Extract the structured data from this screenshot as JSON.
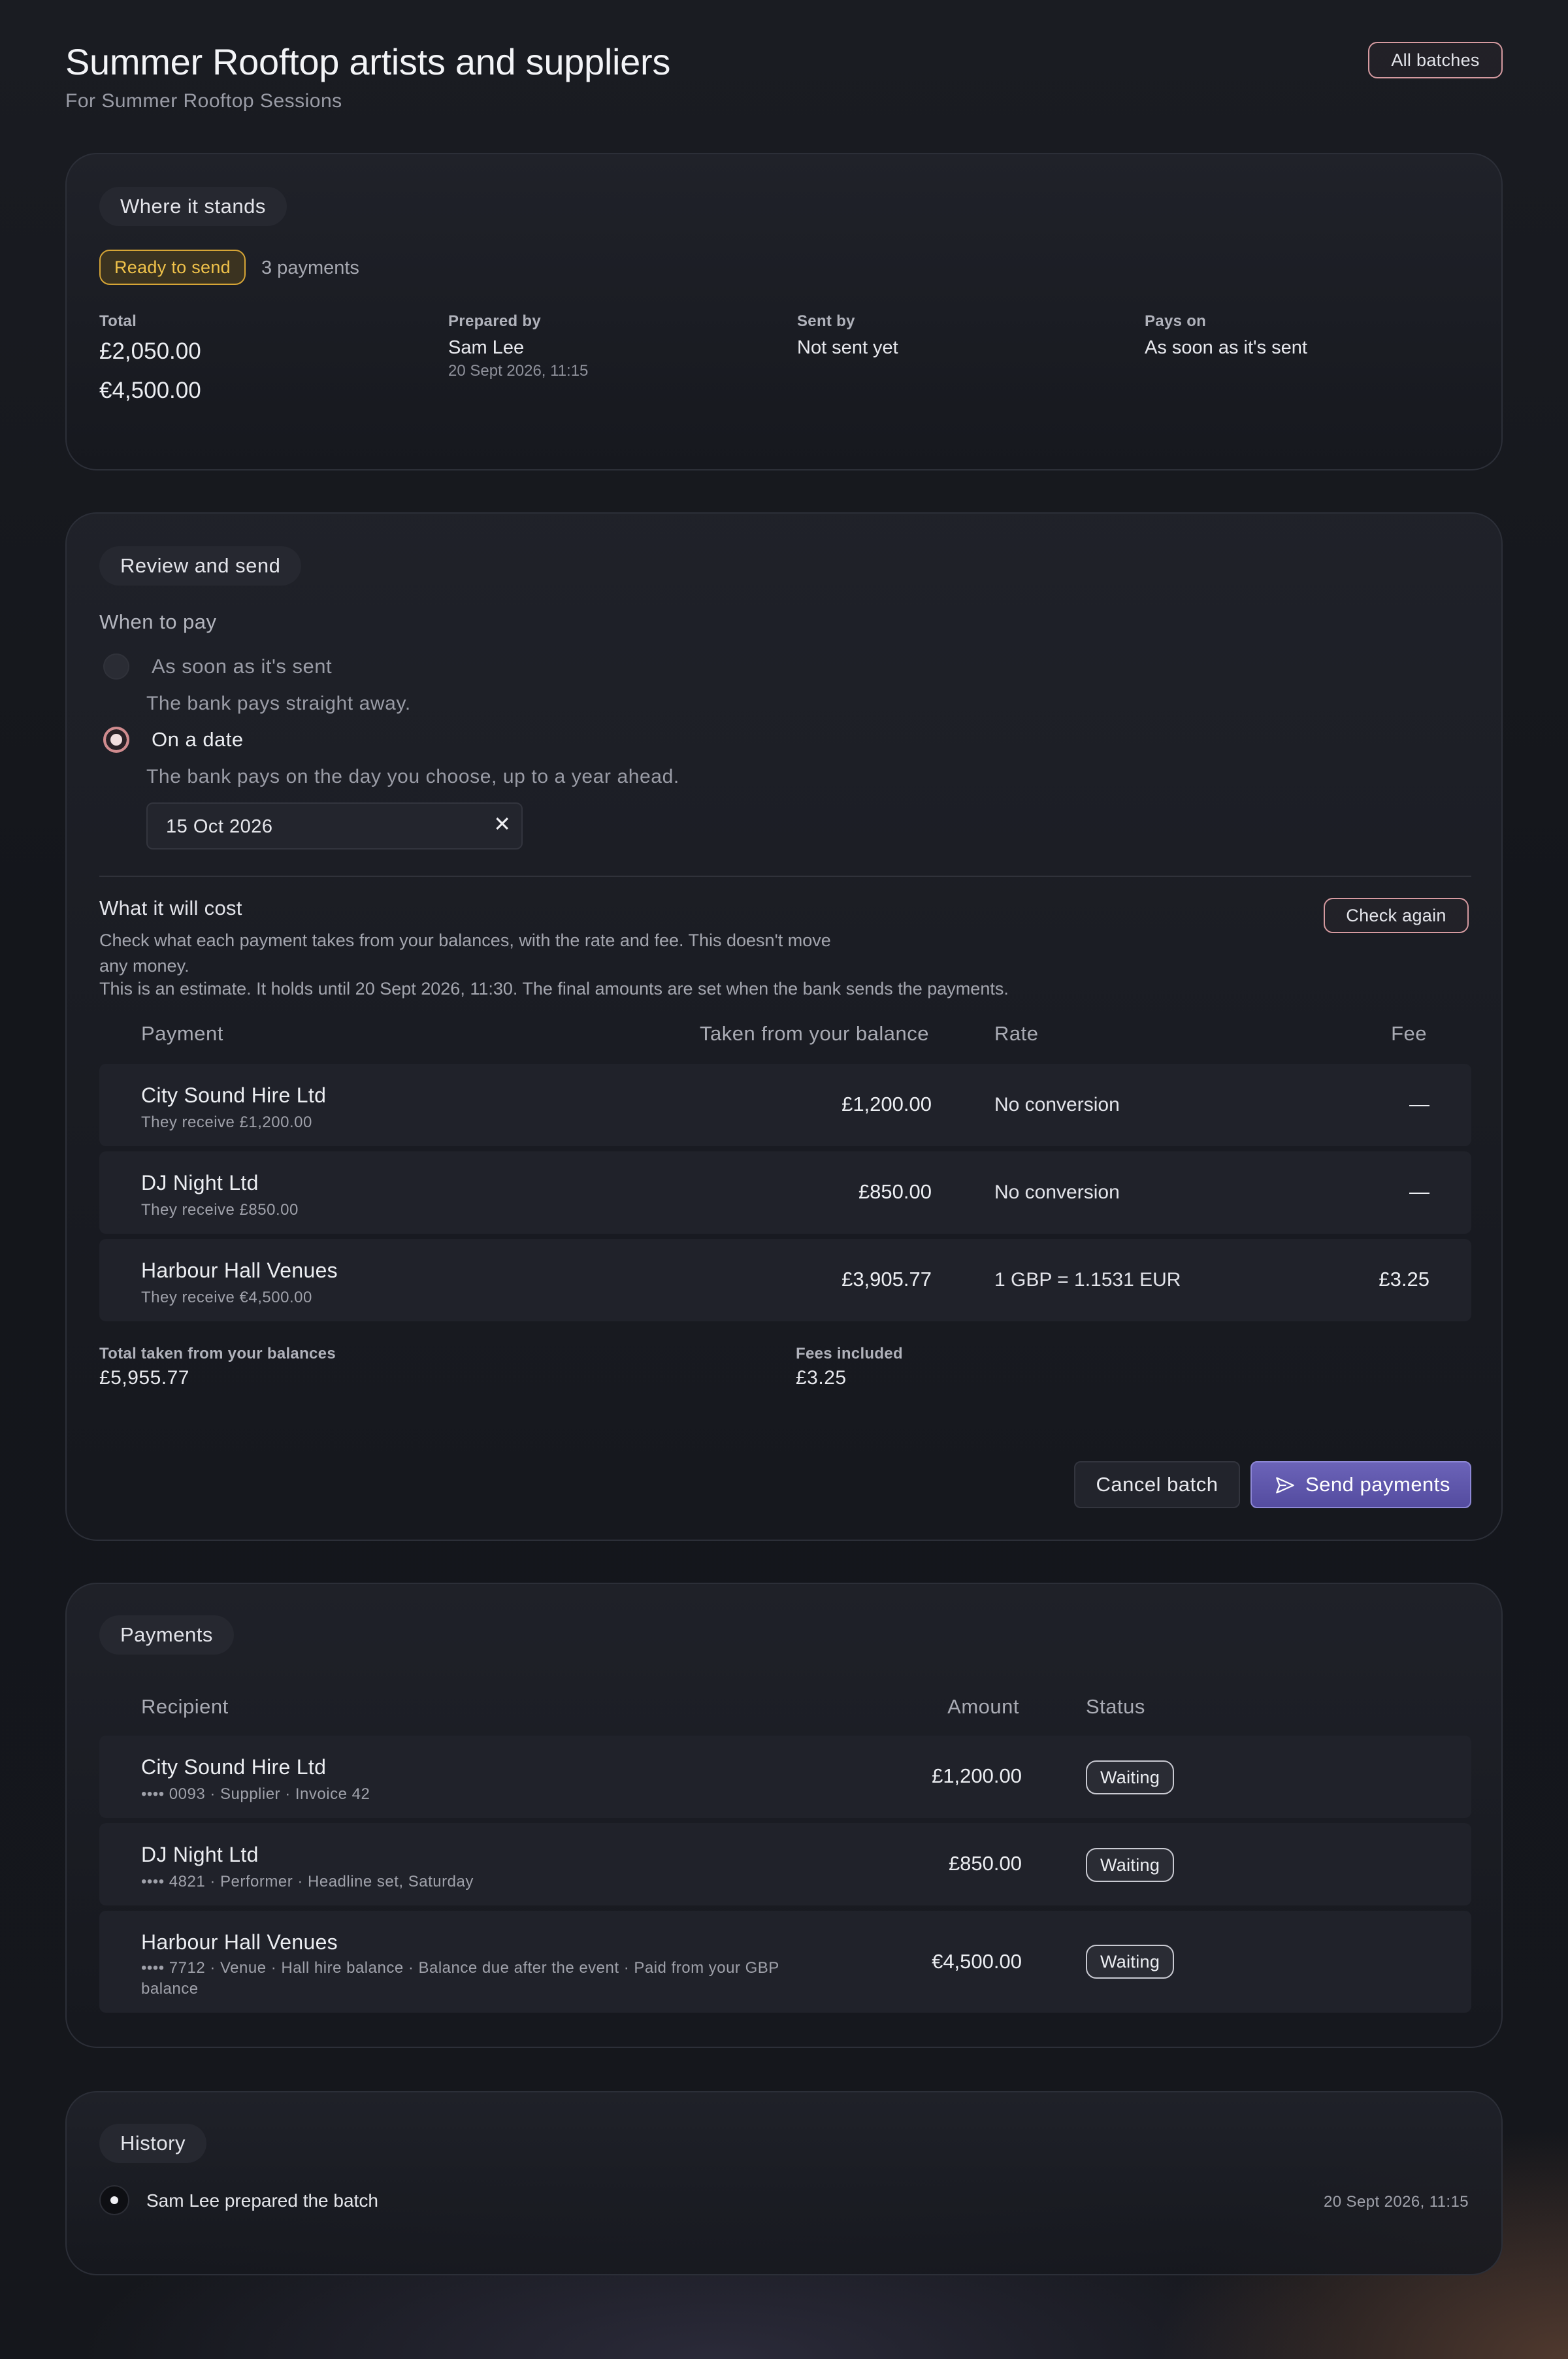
{
  "header": {
    "title": "Summer Rooftop artists and suppliers",
    "subtitle": "For Summer Rooftop Sessions",
    "all_batches_label": "All batches"
  },
  "status": {
    "heading": "Where it stands",
    "badge": "Ready to send",
    "count": "3 payments",
    "total_label": "Total",
    "total_gbp": "£2,050.00",
    "total_eur": "€4,500.00",
    "prepared_label": "Prepared by",
    "prepared_by": "Sam Lee",
    "prepared_at": "20 Sept 2026, 11:15",
    "sent_label": "Sent by",
    "sent_by": "Not sent yet",
    "pays_label": "Pays on",
    "pays_on": "As soon as it's sent"
  },
  "review": {
    "heading": "Review and send",
    "when_label": "When to pay",
    "options": [
      {
        "label": "As soon as it's sent",
        "help": "The bank pays straight away.",
        "selected": false
      },
      {
        "label": "On a date",
        "help": "The bank pays on the day you choose, up to a year ahead.",
        "selected": true
      }
    ],
    "date_value": "15 Oct 2026",
    "cost_title": "What it will cost",
    "cost_desc": "Check what each payment takes from your balances, with the rate and fee. This doesn't move any money.",
    "cost_note": "This is an estimate. It holds until 20 Sept 2026, 11:30. The final amounts are set when the bank sends the payments.",
    "check_again_label": "Check again",
    "columns": {
      "payment": "Payment",
      "taken": "Taken from your balance",
      "rate": "Rate",
      "fee": "Fee"
    },
    "rows": [
      {
        "name": "City Sound Hire Ltd",
        "sub": "They receive £1,200.00",
        "taken": "£1,200.00",
        "rate": "No conversion",
        "fee": "—"
      },
      {
        "name": "DJ Night Ltd",
        "sub": "They receive £850.00",
        "taken": "£850.00",
        "rate": "No conversion",
        "fee": "—"
      },
      {
        "name": "Harbour Hall Venues",
        "sub": "They receive €4,500.00",
        "taken": "£3,905.77",
        "rate": "1 GBP = 1.1531 EUR",
        "fee": "£3.25"
      }
    ],
    "total_taken_label": "Total taken from your balances",
    "total_taken": "£5,955.77",
    "fees_label": "Fees included",
    "fees": "£3.25",
    "cancel_label": "Cancel batch",
    "send_label": "Send payments"
  },
  "payments": {
    "heading": "Payments",
    "columns": {
      "recipient": "Recipient",
      "amount": "Amount",
      "status": "Status"
    },
    "rows": [
      {
        "name": "City Sound Hire Ltd",
        "sub": "•••• 0093 · Supplier · Invoice 42",
        "amount": "£1,200.00",
        "status": "Waiting"
      },
      {
        "name": "DJ Night Ltd",
        "sub": "•••• 4821 · Performer · Headline set, Saturday",
        "amount": "£850.00",
        "status": "Waiting"
      },
      {
        "name": "Harbour Hall Venues",
        "sub": "•••• 7712 · Venue · Hall hire balance · Balance due after the event · Paid from your GBP balance",
        "amount": "€4,500.00",
        "status": "Waiting"
      }
    ]
  },
  "history": {
    "heading": "History",
    "items": [
      {
        "text": "Sam Lee prepared the batch",
        "time": "20 Sept 2026, 11:15"
      }
    ]
  },
  "colors": {
    "accent": "#6b63b8",
    "ready_badge": "#f0c24a",
    "outline_button": "#d59aa0"
  }
}
